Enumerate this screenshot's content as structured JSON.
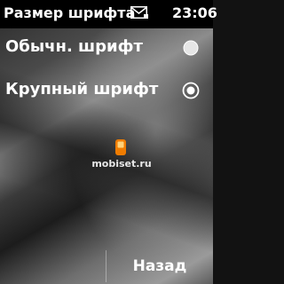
{
  "status_bar": {
    "title": "Размер шрифта",
    "time": "23:06",
    "message_icon": "envelope-icon"
  },
  "options": [
    {
      "label": "Обычн. шрифт",
      "selected": false
    },
    {
      "label": "Крупный шрифт",
      "selected": true
    }
  ],
  "watermark": {
    "text": "mobiset.ru",
    "logo_color": "#f07c00"
  },
  "softkeys": {
    "back_label": "Назад"
  }
}
